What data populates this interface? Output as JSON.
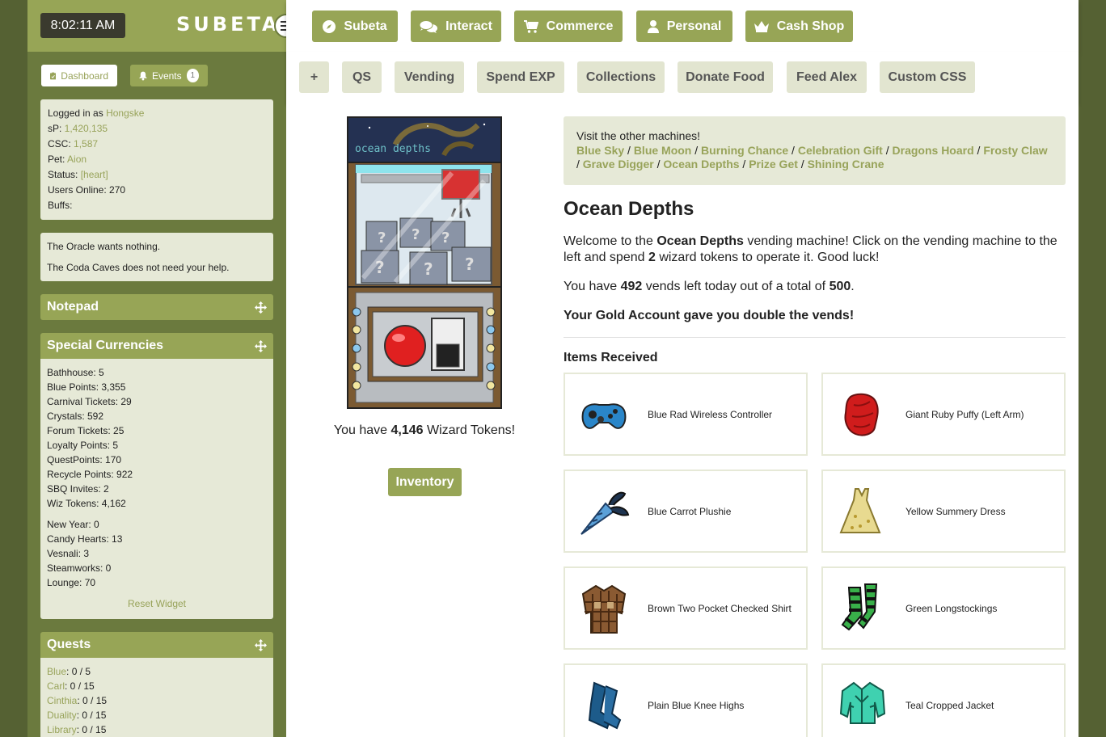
{
  "sidebar": {
    "clock": "8:02:11 AM",
    "logo": "SUBETA",
    "tabs": {
      "dashboard": "Dashboard",
      "events": "Events",
      "events_badge": "1"
    },
    "account": {
      "logged_in_label": "Logged in as ",
      "user": "Hongske",
      "sp_label": "sP: ",
      "sp": "1,420,135",
      "csc_label": "CSC: ",
      "csc": "1,587",
      "pet_label": "Pet: ",
      "pet": "Aion",
      "status_label": "Status: ",
      "status": "[heart]",
      "users_online": "Users Online: 270",
      "buffs": "Buffs:"
    },
    "oracle": [
      "The Oracle wants nothing.",
      "The Coda Caves does not need your help."
    ],
    "notepad_title": "Notepad",
    "currencies_title": "Special Currencies",
    "currencies": [
      "Bathhouse: 5",
      "Blue Points: 3,355",
      "Carnival Tickets: 29",
      "Crystals: 592",
      "Forum Tickets: 25",
      "Loyalty Points: 5",
      "QuestPoints: 170",
      "Recycle Points: 922",
      "SBQ Invites: 2",
      "Wiz Tokens: 4,162"
    ],
    "currencies2": [
      "New Year: 0",
      "Candy Hearts: 13",
      "Vesnali: 3",
      "Steamworks: 0",
      "Lounge: 70"
    ],
    "reset_widget": "Reset Widget",
    "quests_title": "Quests",
    "quests": [
      {
        "name": "Blue",
        "value": ": 0 / 5"
      },
      {
        "name": "Carl",
        "value": ": 0 / 15"
      },
      {
        "name": "Cinthia",
        "value": ": 0 / 15"
      },
      {
        "name": "Duality",
        "value": ": 0 / 15"
      },
      {
        "name": "Library",
        "value": ": 0 / 15"
      }
    ]
  },
  "topnav": [
    "Subeta",
    "Interact",
    "Commerce",
    "Personal",
    "Cash Shop"
  ],
  "subnav": [
    "+",
    "QS",
    "Vending",
    "Spend EXP",
    "Collections",
    "Donate Food",
    "Feed Alex",
    "Custom CSS"
  ],
  "machine": {
    "sign": "ocean depths",
    "tokens_pre": "You have ",
    "tokens": "4,146",
    "tokens_post": " Wizard Tokens!",
    "inventory": "Inventory"
  },
  "visit": {
    "intro": "Visit the other machines!",
    "machines": [
      "Blue Sky",
      "Blue Moon",
      "Burning Chance",
      "Celebration Gift",
      "Dragons Hoard",
      "Frosty Claw",
      "Grave Digger",
      "Ocean Depths",
      "Prize Get",
      "Shining Crane"
    ],
    "sep": " / "
  },
  "content": {
    "title": "Ocean Depths",
    "welcome_pre": "Welcome to the ",
    "welcome_name": "Ocean Depths",
    "welcome_mid": " vending machine! Click on the vending machine to the left and spend ",
    "welcome_cost": "2",
    "welcome_post": " wizard tokens to operate it. Good luck!",
    "vends_pre": "You have ",
    "vends_left": "492",
    "vends_mid": " vends left today out of a total of ",
    "vends_total": "500",
    "vends_post": ".",
    "gold": "Your Gold Account gave you double the vends!",
    "items_heading": "Items Received",
    "items": [
      "Blue Rad Wireless Controller",
      "Giant Ruby Puffy (Left Arm)",
      "Blue Carrot Plushie",
      "Yellow Summery Dress",
      "Brown Two Pocket Checked Shirt",
      "Green Longstockings",
      "Plain Blue Knee Highs",
      "Teal Cropped Jacket"
    ]
  },
  "colors": {
    "accent": "#97a556",
    "sidebar": "#6b7a3e",
    "panel": "#e6e9d7",
    "link": "#98a35a"
  }
}
